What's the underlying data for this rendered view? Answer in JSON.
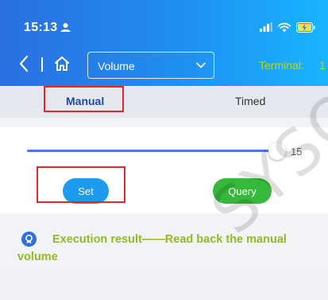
{
  "status_bar": {
    "time": "15:13",
    "icons": [
      "person-icon",
      "signal-icon",
      "wifi-icon",
      "battery-charging-icon"
    ]
  },
  "nav": {
    "back_icon": "chevron-left-icon",
    "home_icon": "home-icon",
    "select": {
      "value": "Volume",
      "chevron_icon": "chevron-down-icon"
    },
    "terminal_label": "Terminal:",
    "terminal_extra": "1"
  },
  "tabs": [
    {
      "label": "Manual",
      "selected": true
    },
    {
      "label": "Timed",
      "selected": false
    }
  ],
  "volume": {
    "value": "15",
    "level": 1.0
  },
  "buttons": {
    "set_label": "Set",
    "query_label": "Query"
  },
  "result": {
    "icon": "result-icon",
    "text": "Execution result——Read back the manual volume"
  },
  "watermark": "SYSOL",
  "colors": {
    "header_start": "#2a6fe0",
    "header_end": "#18b4ff",
    "accent": "#4c78ec",
    "set_button": "#1e9bf0",
    "query_button": "#36b83a",
    "result_text": "#8fbc1f",
    "highlight": "#e3262c"
  }
}
